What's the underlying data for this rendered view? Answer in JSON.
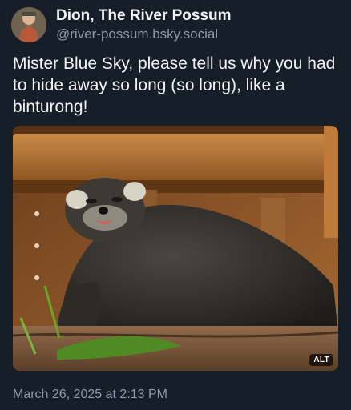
{
  "post": {
    "author": {
      "display_name": "Dion, The River Possum",
      "handle": "@river-possum.bsky.social",
      "avatar_icon": "avatar-photo"
    },
    "text": "Mister Blue Sky, please tell us why you had to hide away so long (so long), like a binturong!",
    "image": {
      "alt_badge": "ALT"
    },
    "timestamp": "March 26, 2025 at 2:13 PM"
  },
  "colors": {
    "background": "#161e27",
    "primary_text": "#f1f3f5",
    "secondary_text": "#8c9aab"
  }
}
